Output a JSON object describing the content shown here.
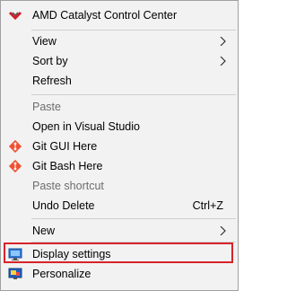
{
  "menu": {
    "items": [
      {
        "label": "AMD Catalyst Control Center",
        "icon": "amd-icon"
      },
      {
        "label": "View",
        "submenu": true
      },
      {
        "label": "Sort by",
        "submenu": true
      },
      {
        "label": "Refresh"
      },
      {
        "label": "Paste",
        "disabled": true
      },
      {
        "label": "Open in Visual Studio"
      },
      {
        "label": "Git GUI Here",
        "icon": "git-icon"
      },
      {
        "label": "Git Bash Here",
        "icon": "git-icon"
      },
      {
        "label": "Paste shortcut",
        "disabled": true
      },
      {
        "label": "Undo Delete",
        "shortcut": "Ctrl+Z"
      },
      {
        "label": "New",
        "submenu": true
      },
      {
        "label": "Display settings",
        "icon": "display-icon",
        "highlighted": true
      },
      {
        "label": "Personalize",
        "icon": "personalize-icon"
      }
    ]
  },
  "colors": {
    "highlight_border": "#d8232a",
    "menu_background": "#f2f2f2",
    "disabled_text": "#6d6d6d"
  }
}
